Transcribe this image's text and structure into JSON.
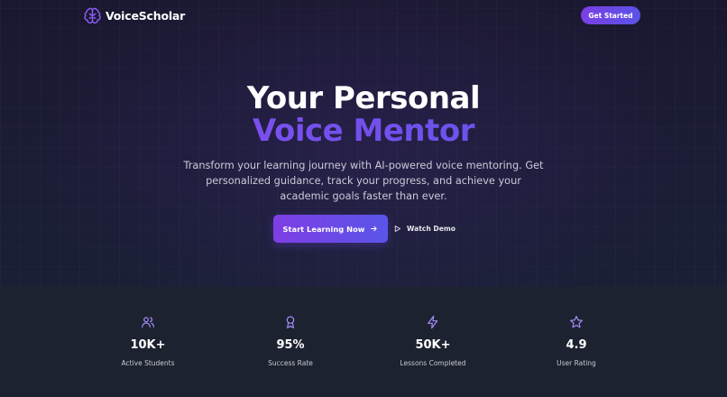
{
  "nav": {
    "brand": "VoiceScholar",
    "brand_icon": "brain-icon",
    "cta_label": "Get Started"
  },
  "hero": {
    "title_line1": "Your Personal",
    "title_line2": "Voice Mentor",
    "subtitle": "Transform your learning journey with AI-powered voice mentoring. Get personalized guidance, track your progress, and achieve your academic goals faster than ever.",
    "primary_button": "Start Learning Now",
    "primary_button_icon": "arrow-right-icon",
    "secondary_button": "Watch Demo",
    "secondary_button_icon": "play-icon"
  },
  "stats": [
    {
      "icon": "users-icon",
      "value": "10K+",
      "label": "Active Students"
    },
    {
      "icon": "award-icon",
      "value": "95%",
      "label": "Success Rate"
    },
    {
      "icon": "lightning-icon",
      "value": "50K+",
      "label": "Lessons Completed"
    },
    {
      "icon": "star-icon",
      "value": "4.9",
      "label": "User Rating"
    }
  ],
  "colors": {
    "accent_purple": "#7b3fe4",
    "accent_indigo": "#5b52e8",
    "hero_bg": "#1b1c36",
    "stats_bg": "#1d2230",
    "icon_color": "#a78bfa"
  }
}
